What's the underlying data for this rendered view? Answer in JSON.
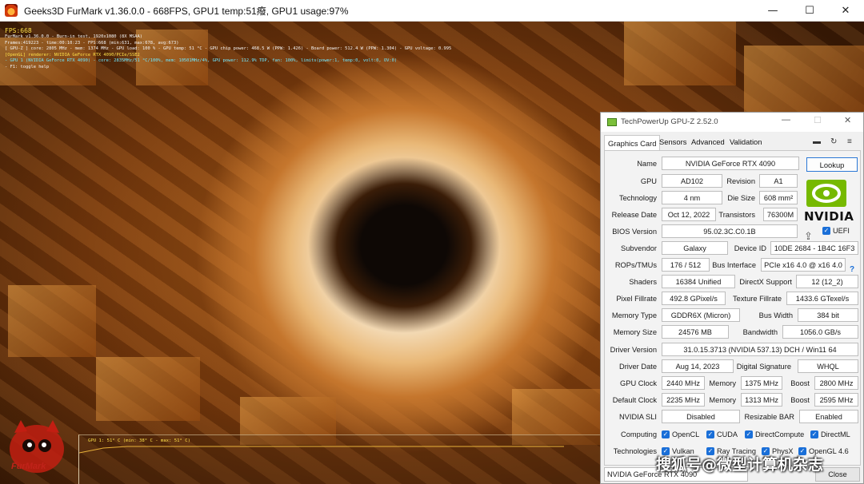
{
  "furmark": {
    "title": "Geeks3D FurMark v1.36.0.0 - 668FPS, GPU1 temp:51癈, GPU1 usage:97%",
    "osd": {
      "fps_line": "FPS:668",
      "line1": "FurMark v1.36.0.0 - Burn-in test, 1920x1080 (8X MSAA)",
      "line2": "Frames:419223 - time:00:10:23 - FPS:668 (min:631, max:678, avg:673)",
      "line3": "[ GPU-Z ] core: 2805 MHz - mem: 1374 MHz - GPU load: 100 % - GPU temp: 51 °C - GPU chip power: 468.5 W (PPW: 1.426) - Board power: 512.4 W (PPW: 1.304) - GPU voltage: 0.995 V",
      "line4": "[OpenGL] renderer: NVIDIA GeForce RTX 4090/PCIe/SSE2",
      "line5": "- GPU 1 (NVIDIA GeForce RTX 4090) - core: 2835MHz/51 °C/100%, mem: 10501MHz/4%, GPU power: 112.9% TDP, fan: 100%, limits(power:1, temp:0, volt:0, OV:0)",
      "line6": "- F1: toggle help"
    },
    "temp_label": "GPU 1: 51° C (min: 38° C - max: 51° C)",
    "logo_text": "FurMark",
    "controls": {
      "minimize": "—",
      "maximize": "☐",
      "close": "✕"
    }
  },
  "gpuz": {
    "title": "TechPowerUp GPU-Z 2.52.0",
    "controls": {
      "minimize": "—",
      "maximize": "☐",
      "close": "✕"
    },
    "tabs": [
      "Graphics Card",
      "Sensors",
      "Advanced",
      "Validation"
    ],
    "lookup": "Lookup",
    "nvidia_wordmark": "NVIDIA",
    "uefi": "UEFI",
    "help": "?",
    "fields": {
      "name": {
        "label": "Name",
        "value": "NVIDIA GeForce RTX 4090"
      },
      "gpu": {
        "label": "GPU",
        "value": "AD102"
      },
      "revision": {
        "label": "Revision",
        "value": "A1"
      },
      "technology": {
        "label": "Technology",
        "value": "4 nm"
      },
      "die_size": {
        "label": "Die Size",
        "value": "608 mm²"
      },
      "release_date": {
        "label": "Release Date",
        "value": "Oct 12, 2022"
      },
      "transistors": {
        "label": "Transistors",
        "value": "76300M"
      },
      "bios_version": {
        "label": "BIOS Version",
        "value": "95.02.3C.C0.1B"
      },
      "subvendor": {
        "label": "Subvendor",
        "value": "Galaxy"
      },
      "device_id": {
        "label": "Device ID",
        "value": "10DE 2684 - 1B4C 16F3"
      },
      "rops_tmus": {
        "label": "ROPs/TMUs",
        "value": "176 / 512"
      },
      "bus_interface": {
        "label": "Bus Interface",
        "value": "PCIe x16 4.0 @ x16 4.0"
      },
      "shaders": {
        "label": "Shaders",
        "value": "16384 Unified"
      },
      "directx": {
        "label": "DirectX Support",
        "value": "12 (12_2)"
      },
      "pixel_fillrate": {
        "label": "Pixel Fillrate",
        "value": "492.8 GPixel/s"
      },
      "texture_fillrate": {
        "label": "Texture Fillrate",
        "value": "1433.6 GTexel/s"
      },
      "memory_type": {
        "label": "Memory Type",
        "value": "GDDR6X (Micron)"
      },
      "bus_width": {
        "label": "Bus Width",
        "value": "384 bit"
      },
      "memory_size": {
        "label": "Memory Size",
        "value": "24576 MB"
      },
      "bandwidth": {
        "label": "Bandwidth",
        "value": "1056.0 GB/s"
      },
      "driver_version": {
        "label": "Driver Version",
        "value": "31.0.15.3713 (NVIDIA 537.13) DCH / Win11 64"
      },
      "driver_date": {
        "label": "Driver Date",
        "value": "Aug 14, 2023"
      },
      "digital_signature": {
        "label": "Digital Signature",
        "value": "WHQL"
      },
      "gpu_clock": {
        "label": "GPU Clock",
        "value": "2440 MHz"
      },
      "gpu_clock_memory": {
        "label": "Memory",
        "value": "1375 MHz"
      },
      "gpu_clock_boost": {
        "label": "Boost",
        "value": "2800 MHz"
      },
      "default_clock": {
        "label": "Default Clock",
        "value": "2235 MHz"
      },
      "default_clock_memory": {
        "label": "Memory",
        "value": "1313 MHz"
      },
      "default_clock_boost": {
        "label": "Boost",
        "value": "2595 MHz"
      },
      "nvidia_sli": {
        "label": "NVIDIA SLI",
        "value": "Disabled"
      },
      "resizable_bar": {
        "label": "Resizable BAR",
        "value": "Enabled"
      }
    },
    "computing": {
      "label": "Computing",
      "items": [
        "OpenCL",
        "CUDA",
        "DirectCompute",
        "DirectML"
      ]
    },
    "technologies": {
      "label": "Technologies",
      "items": [
        "Vulkan",
        "Ray Tracing",
        "PhysX",
        "OpenGL 4.6"
      ]
    },
    "footer_select": "NVIDIA GeForce RTX 4090",
    "close_button": "Close"
  },
  "watermark": "搜狐号@微型计算机杂志"
}
